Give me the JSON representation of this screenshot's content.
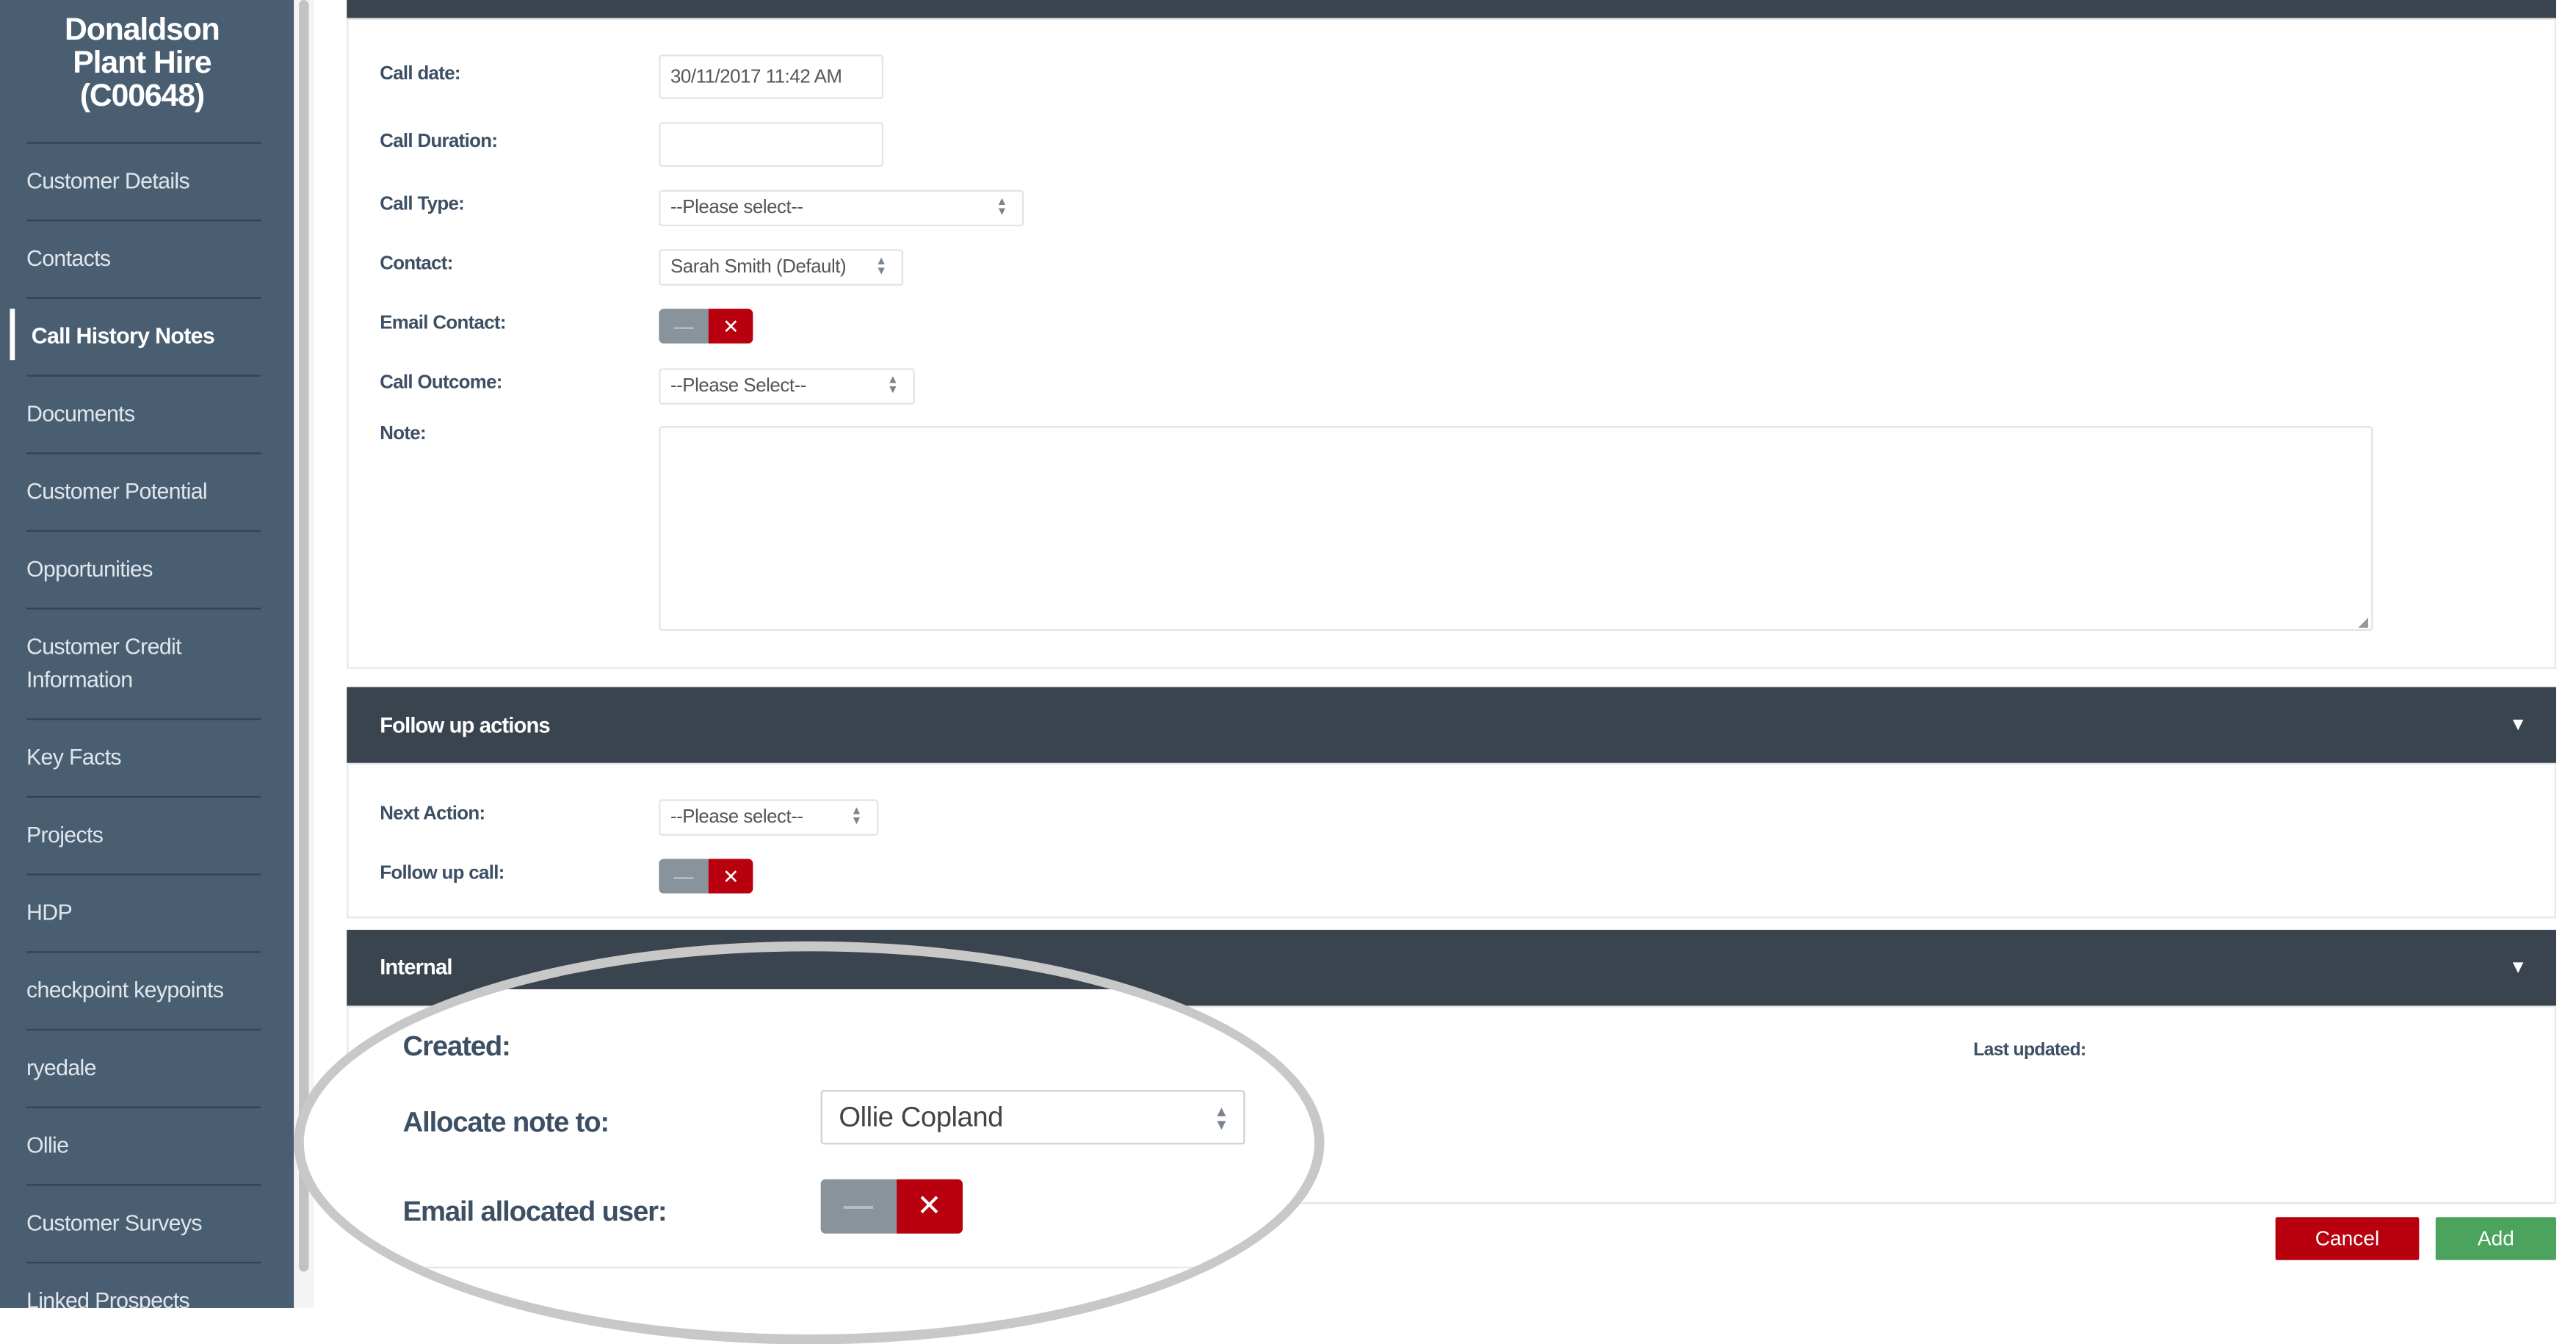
{
  "sidebar": {
    "title_lines": [
      "Donaldson",
      "Plant Hire",
      "(C00648)"
    ],
    "items": [
      {
        "label": "Customer Details"
      },
      {
        "label": "Contacts"
      },
      {
        "label": "Call History Notes",
        "active": true
      },
      {
        "label": "Documents"
      },
      {
        "label": "Customer Potential"
      },
      {
        "label": "Opportunities"
      },
      {
        "label": "Customer Credit Information"
      },
      {
        "label": "Key Facts"
      },
      {
        "label": "Projects"
      },
      {
        "label": "HDP"
      },
      {
        "label": "checkpoint keypoints"
      },
      {
        "label": "ryedale"
      },
      {
        "label": "Ollie"
      },
      {
        "label": "Customer Surveys"
      },
      {
        "label": "Linked Prospects"
      }
    ]
  },
  "call_form": {
    "call_date_label": "Call date:",
    "call_date_value": "30/11/2017 11:42 AM",
    "call_duration_label": "Call Duration:",
    "call_duration_value": "",
    "call_type_label": "Call Type:",
    "call_type_value": "--Please select--",
    "contact_label": "Contact:",
    "contact_value": "Sarah Smith (Default)",
    "email_contact_label": "Email Contact:",
    "email_contact_on": false,
    "call_outcome_label": "Call Outcome:",
    "call_outcome_value": "--Please Select--",
    "note_label": "Note:",
    "note_value": ""
  },
  "follow_up": {
    "header": "Follow up actions",
    "next_action_label": "Next Action:",
    "next_action_value": "--Please select--",
    "follow_up_call_label": "Follow up call:",
    "follow_up_call_on": false
  },
  "internal": {
    "header": "Internal",
    "created_label": "Created:",
    "last_updated_label": "Last updated:",
    "allocate_label": "Allocate note to:",
    "allocate_value": "Ollie Copland",
    "email_allocated_label": "Email allocated user:",
    "email_allocated_on": false
  },
  "icons": {
    "toggle_off": "—",
    "toggle_x": "✕",
    "caret": "▼",
    "select_arrows": "▲▼"
  },
  "actions": {
    "cancel_label": "Cancel",
    "add_label": "Add"
  },
  "colors": {
    "sidebar": "#4a5e72",
    "header": "#3a444f",
    "cancel": "#b8000e",
    "add": "#4ba35e",
    "toggle_off": "#89939b"
  }
}
